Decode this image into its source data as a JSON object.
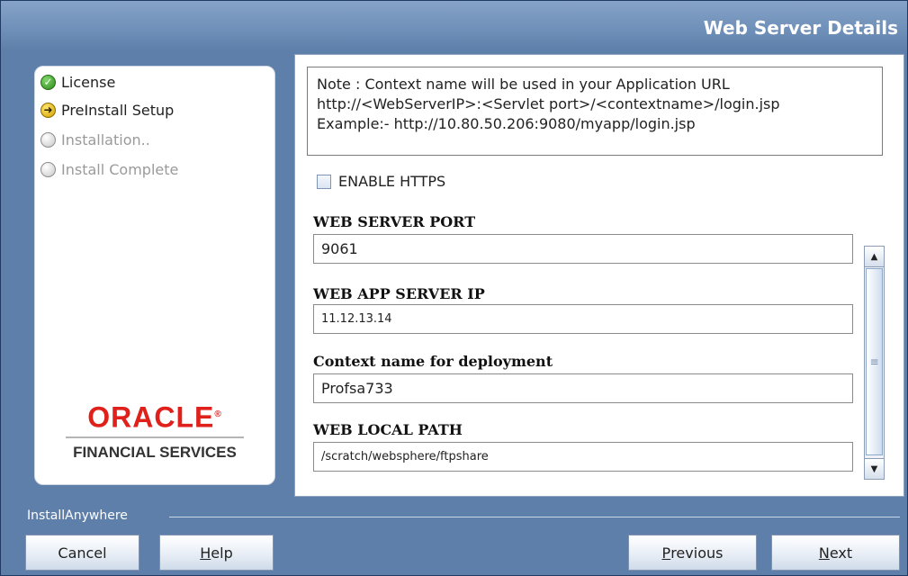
{
  "header": {
    "title": "Web Server Details"
  },
  "steps": [
    {
      "label": "License",
      "state": "done"
    },
    {
      "label": "PreInstall Setup",
      "state": "current"
    },
    {
      "label": "Installation..",
      "state": "pending"
    },
    {
      "label": "Install Complete",
      "state": "pending"
    }
  ],
  "logo": {
    "brand": "ORACLE",
    "subtitle": "FINANCIAL SERVICES"
  },
  "note": {
    "line1": "Note : Context name will be used in your Application URL",
    "line2": "http://<WebServerIP>:<Servlet port>/<contextname>/login.jsp",
    "line3": "Example:- http://10.80.50.206:9080/myapp/login.jsp"
  },
  "https": {
    "label": "ENABLE HTTPS",
    "checked": false
  },
  "fields": {
    "port": {
      "label": "WEB SERVER PORT",
      "value": "9061"
    },
    "ip": {
      "label": "WEB APP SERVER IP",
      "value": "11.12.13.14"
    },
    "context": {
      "label": "Context name for deployment",
      "value": "Profsa733"
    },
    "local_path": {
      "label": "WEB LOCAL PATH",
      "value": "/scratch/websphere/ftpshare"
    }
  },
  "footer": {
    "brand": "InstallAnywhere",
    "cancel": {
      "pre": "Cancel",
      "u": "",
      "post": ""
    },
    "help": {
      "pre": "",
      "u": "H",
      "post": "elp"
    },
    "previous": {
      "pre": "",
      "u": "P",
      "post": "revious"
    },
    "next": {
      "pre": "",
      "u": "N",
      "post": "ext"
    }
  },
  "colors": {
    "frame": "#5e7fa9",
    "oracle_red": "#e0211b",
    "done": "#2f8a1c",
    "current": "#d4a200"
  },
  "icons": {
    "done": "check-icon",
    "current": "arrow-right-icon",
    "pending": "empty-circle-icon"
  }
}
